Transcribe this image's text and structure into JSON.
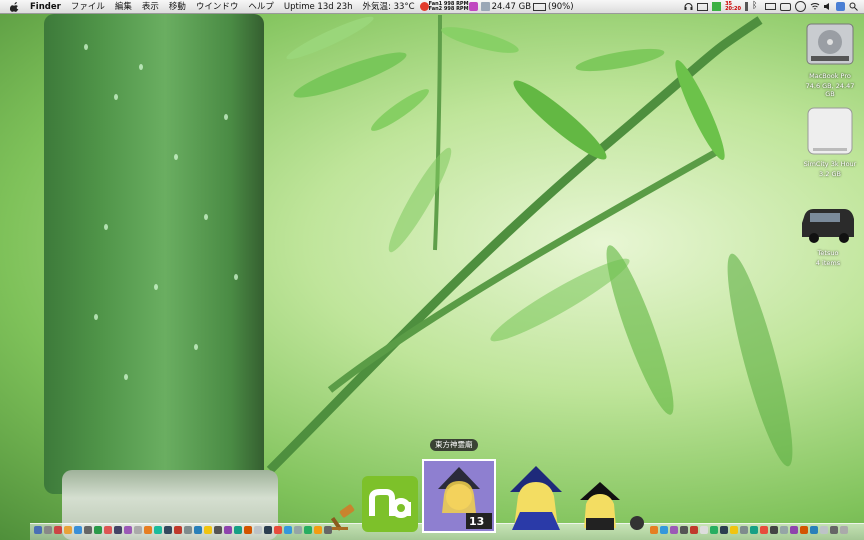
{
  "menubar": {
    "apple_icon": "apple-icon",
    "app_name": "Finder",
    "menus": [
      "ファイル",
      "編集",
      "表示",
      "移動",
      "ウインドウ",
      "ヘルプ"
    ],
    "uptime": "Uptime 13d 23h",
    "temperature": "外気温: 33°C",
    "fan1": "Fan1 998 RPM",
    "fan2": "Fan2 998 RPM",
    "disk_free": "24.47 GB",
    "battery": "(90%)",
    "cpu_temp": "35",
    "clock": "20:20",
    "status_icons": [
      "tomato-icon",
      "itunes-icon",
      "disk-icon",
      "battery-icon",
      "headphones-icon",
      "monitor-icon",
      "green-icon",
      "temperature-icon",
      "bluetooth-icon",
      "keyboard-icon",
      "chat-icon",
      "timemachine-icon",
      "wifi-icon",
      "volume-icon",
      "user-icon",
      "spotlight-icon"
    ]
  },
  "desktop_icons": [
    {
      "name": "MacBook Pro",
      "detail": "74.6 GB, 24.47 GB",
      "icon": "hard-drive-icon"
    },
    {
      "name": "SimCity 3k Hour",
      "detail": "3.2 GB",
      "icon": "disk-image-icon"
    },
    {
      "name": "Tetsuo",
      "detail": "4 items",
      "icon": "van-icon"
    }
  ],
  "dock": {
    "tooltip": "東方神霊廟",
    "featured_apps": [
      {
        "name": "gavel-app",
        "icon": "gavel-icon"
      },
      {
        "name": "na-app",
        "label": "na",
        "icon": "na-icon"
      },
      {
        "name": "th13-app",
        "label": "TH13",
        "icon": "touhou-th13-icon"
      },
      {
        "name": "touhou-app-2",
        "icon": "anime-girl-icon"
      },
      {
        "name": "touhou-app-3",
        "icon": "anime-girl-icon"
      }
    ]
  },
  "colors": {
    "menubar": "#e9e9e9",
    "bamboo": "#4f9448",
    "leaves": "#6cc24a"
  }
}
